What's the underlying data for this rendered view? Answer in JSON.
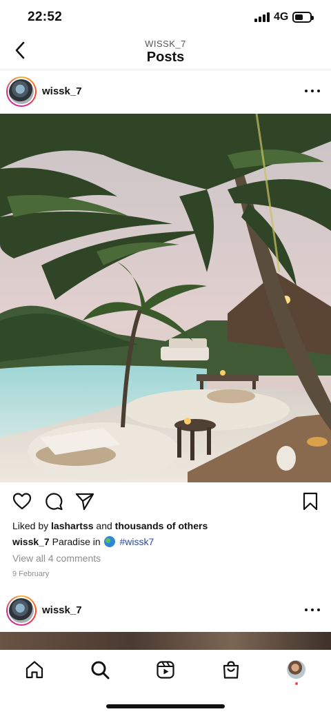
{
  "status": {
    "time": "22:52",
    "network": "4G",
    "battery_level": 0.55
  },
  "header": {
    "subtitle": "WISSK_7",
    "title": "Posts"
  },
  "post": {
    "username": "wissk_7",
    "liked_prefix": "Liked by ",
    "liked_user": "lashartss",
    "liked_mid": " and ",
    "liked_rest": "thousands of others",
    "caption_user": "wissk_7",
    "caption_text": " Paradise in ",
    "caption_hashtag": "#wissk7",
    "view_comments": "View all 4 comments",
    "date": "9 February"
  },
  "next_post": {
    "username": "wissk_7"
  },
  "icons": {
    "back": "chevron-left-icon",
    "more": "more-horizontal-icon",
    "like": "heart-icon",
    "comment": "comment-icon",
    "share": "send-icon",
    "save": "bookmark-icon",
    "home": "home-icon",
    "search": "search-icon",
    "reels": "reels-icon",
    "shop": "shop-icon"
  },
  "colors": {
    "hashtag": "#2b4a9b",
    "notification_dot": "#ed4956",
    "muted": "#8e8e8e"
  }
}
